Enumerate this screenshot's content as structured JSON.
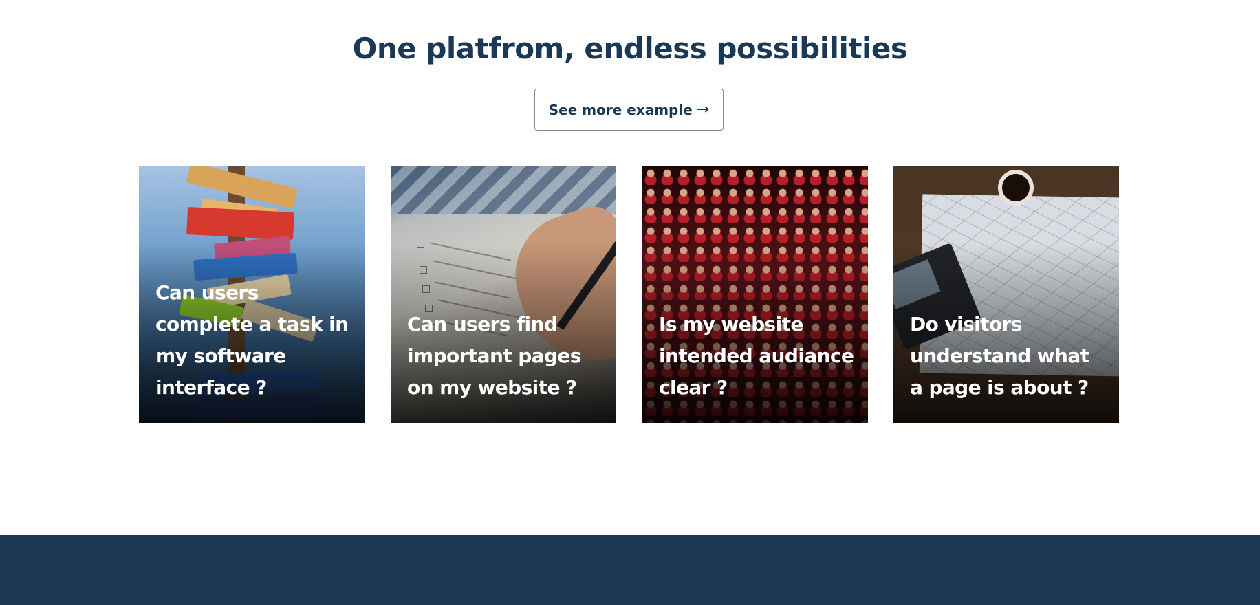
{
  "section": {
    "headline": "One platfrom, endless possibilities",
    "cta": {
      "label": "See more example",
      "arrow": "→"
    }
  },
  "cards": [
    {
      "question": "Can users complete a task in my software interface ?",
      "image": "signpost-photo"
    },
    {
      "question": "Can users find important pages on my website ?",
      "image": "checklist-photo"
    },
    {
      "question": "Is my website intended audiance clear ?",
      "image": "theatre-audience-photo"
    },
    {
      "question": "Do visitors understand what a page is about ?",
      "image": "map-coffee-laptop-photo"
    }
  ],
  "colors": {
    "headline": "#1b3854",
    "cta_border": "#7b8ea3",
    "footer": "#1b3854",
    "card_text": "#ffffff"
  }
}
